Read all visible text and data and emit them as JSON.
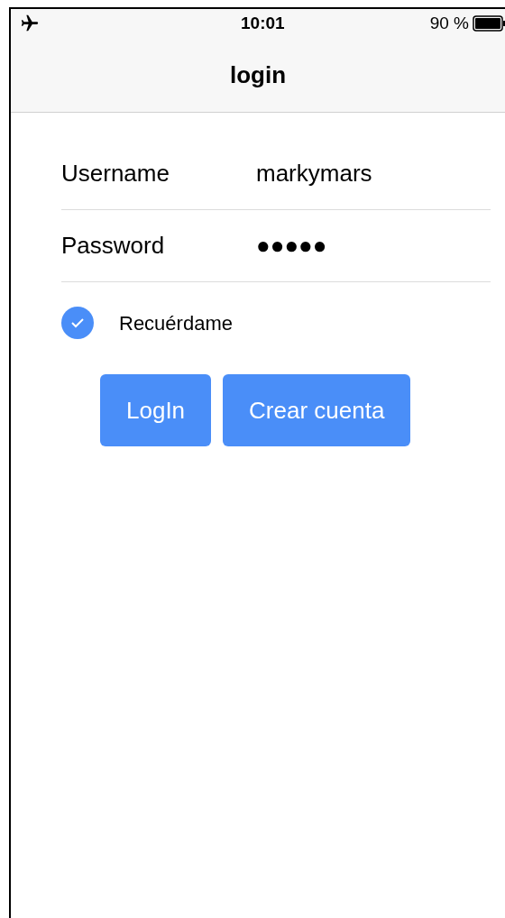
{
  "status_bar": {
    "time": "10:01",
    "battery": "90 %"
  },
  "nav": {
    "title": "login"
  },
  "fields": [
    {
      "label": "Username",
      "value": "markymars"
    },
    {
      "label": "Password",
      "value": "●●●●●"
    }
  ],
  "remember": {
    "label": "Recuérdame",
    "checked": true
  },
  "buttons": [
    "LogIn",
    "Crear cuenta"
  ]
}
